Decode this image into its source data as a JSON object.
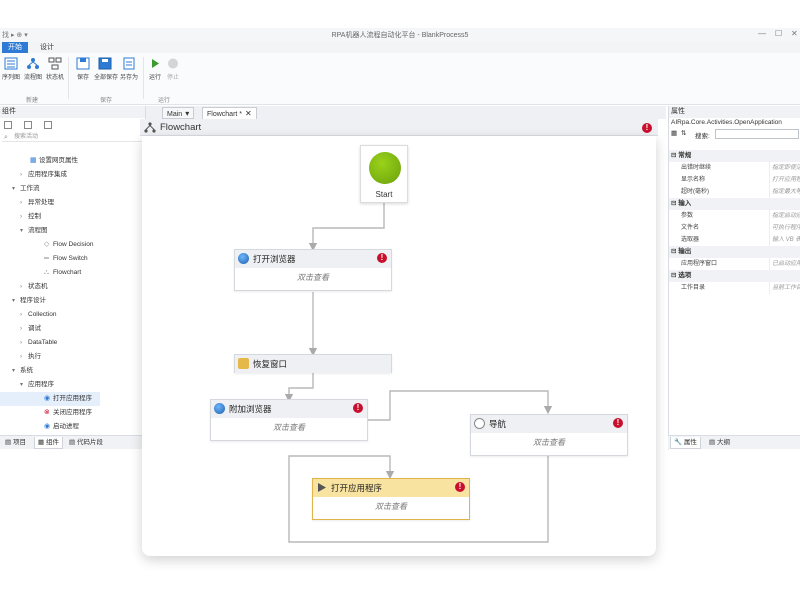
{
  "titlebar": {
    "title": "RPA机器人流程自动化平台 - BlankProcess5",
    "left_text": "找 ▸ ⊕ ▾"
  },
  "ribbon": {
    "tabs": [
      "开始",
      "设计"
    ],
    "buttons": [
      "序列图",
      "流程图",
      "状态机",
      "保存",
      "全部保存",
      "另存为",
      "运行",
      "停止"
    ],
    "groups": [
      "新建",
      "保存",
      "运行"
    ]
  },
  "toolbox": {
    "title": "组件",
    "search_placeholder": "搜索活动",
    "items": [
      {
        "label": "设置网页属性",
        "caret": ""
      },
      {
        "label": "应用程序集成",
        "caret": "›"
      },
      {
        "label": "工作流",
        "caret": "▾"
      },
      {
        "label": "异常处理",
        "caret": "›"
      },
      {
        "label": "控制",
        "caret": "›"
      },
      {
        "label": "流程图",
        "caret": "▾"
      },
      {
        "label": "Flow Decision",
        "caret": ""
      },
      {
        "label": "Flow Switch",
        "caret": ""
      },
      {
        "label": "Flowchart",
        "caret": ""
      },
      {
        "label": "状态机",
        "caret": "›"
      },
      {
        "label": "程序设计",
        "caret": "▾"
      },
      {
        "label": "Collection",
        "caret": "›"
      },
      {
        "label": "调试",
        "caret": "›"
      },
      {
        "label": "DataTable",
        "caret": "›"
      },
      {
        "label": "执行",
        "caret": "›"
      },
      {
        "label": "系统",
        "caret": "▾"
      },
      {
        "label": "应用程序",
        "caret": "▾"
      },
      {
        "label": "打开应用程序",
        "caret": ""
      },
      {
        "label": "关闭应用程序",
        "caret": ""
      },
      {
        "label": "启动进程",
        "caret": ""
      }
    ],
    "bottom_tabs": [
      "项目",
      "组件",
      "代码片段"
    ]
  },
  "doc_tabs": [
    {
      "label": "Main",
      "suffix": "▾"
    },
    {
      "label": "Flowchart *",
      "suffix": "✕"
    }
  ],
  "designer": {
    "title": "Flowchart",
    "start_label": "Start",
    "activities": [
      {
        "id": "open-browser",
        "title": "打开浏览器",
        "body": "双击查看",
        "error": true
      },
      {
        "id": "restore-window",
        "title": "恢复窗口",
        "body": "",
        "error": false
      },
      {
        "id": "attach-browser",
        "title": "附加浏览器",
        "body": "双击查看",
        "error": true
      },
      {
        "id": "navigate",
        "title": "导航",
        "body": "双击查看",
        "error": true
      },
      {
        "id": "open-app",
        "title": "打开应用程序",
        "body": "双击查看",
        "error": true
      }
    ],
    "error_glyph": "!"
  },
  "properties": {
    "title": "属性",
    "subtitle": "AIRpa.Core.Activities.OpenApplication",
    "search_label": "搜索:",
    "categories": [
      {
        "name": "常规",
        "rows": [
          {
            "name": "出错时继续",
            "value": "指定即使活动"
          },
          {
            "name": "显示名称",
            "value": "打开应用程序"
          },
          {
            "name": "超时(毫秒)",
            "value": "指定最大等待"
          }
        ]
      },
      {
        "name": "输入",
        "rows": [
          {
            "name": "参数",
            "value": "指定启动应用"
          },
          {
            "name": "文件名",
            "value": "可执行程序的"
          },
          {
            "name": "选取器",
            "value": "输入 VB 表达"
          }
        ]
      },
      {
        "name": "输出",
        "rows": [
          {
            "name": "应用程序窗口",
            "value": "已启动应用程"
          }
        ]
      },
      {
        "name": "选项",
        "rows": [
          {
            "name": "工作目录",
            "value": "当前工作目录"
          }
        ]
      }
    ],
    "bottom_tabs": [
      "属性",
      "大纲"
    ]
  },
  "colors": {
    "accent": "#2e7bd5",
    "start_green": "#7fbf10",
    "error_red": "#c8102e",
    "selected_header": "#f8e4a0"
  }
}
